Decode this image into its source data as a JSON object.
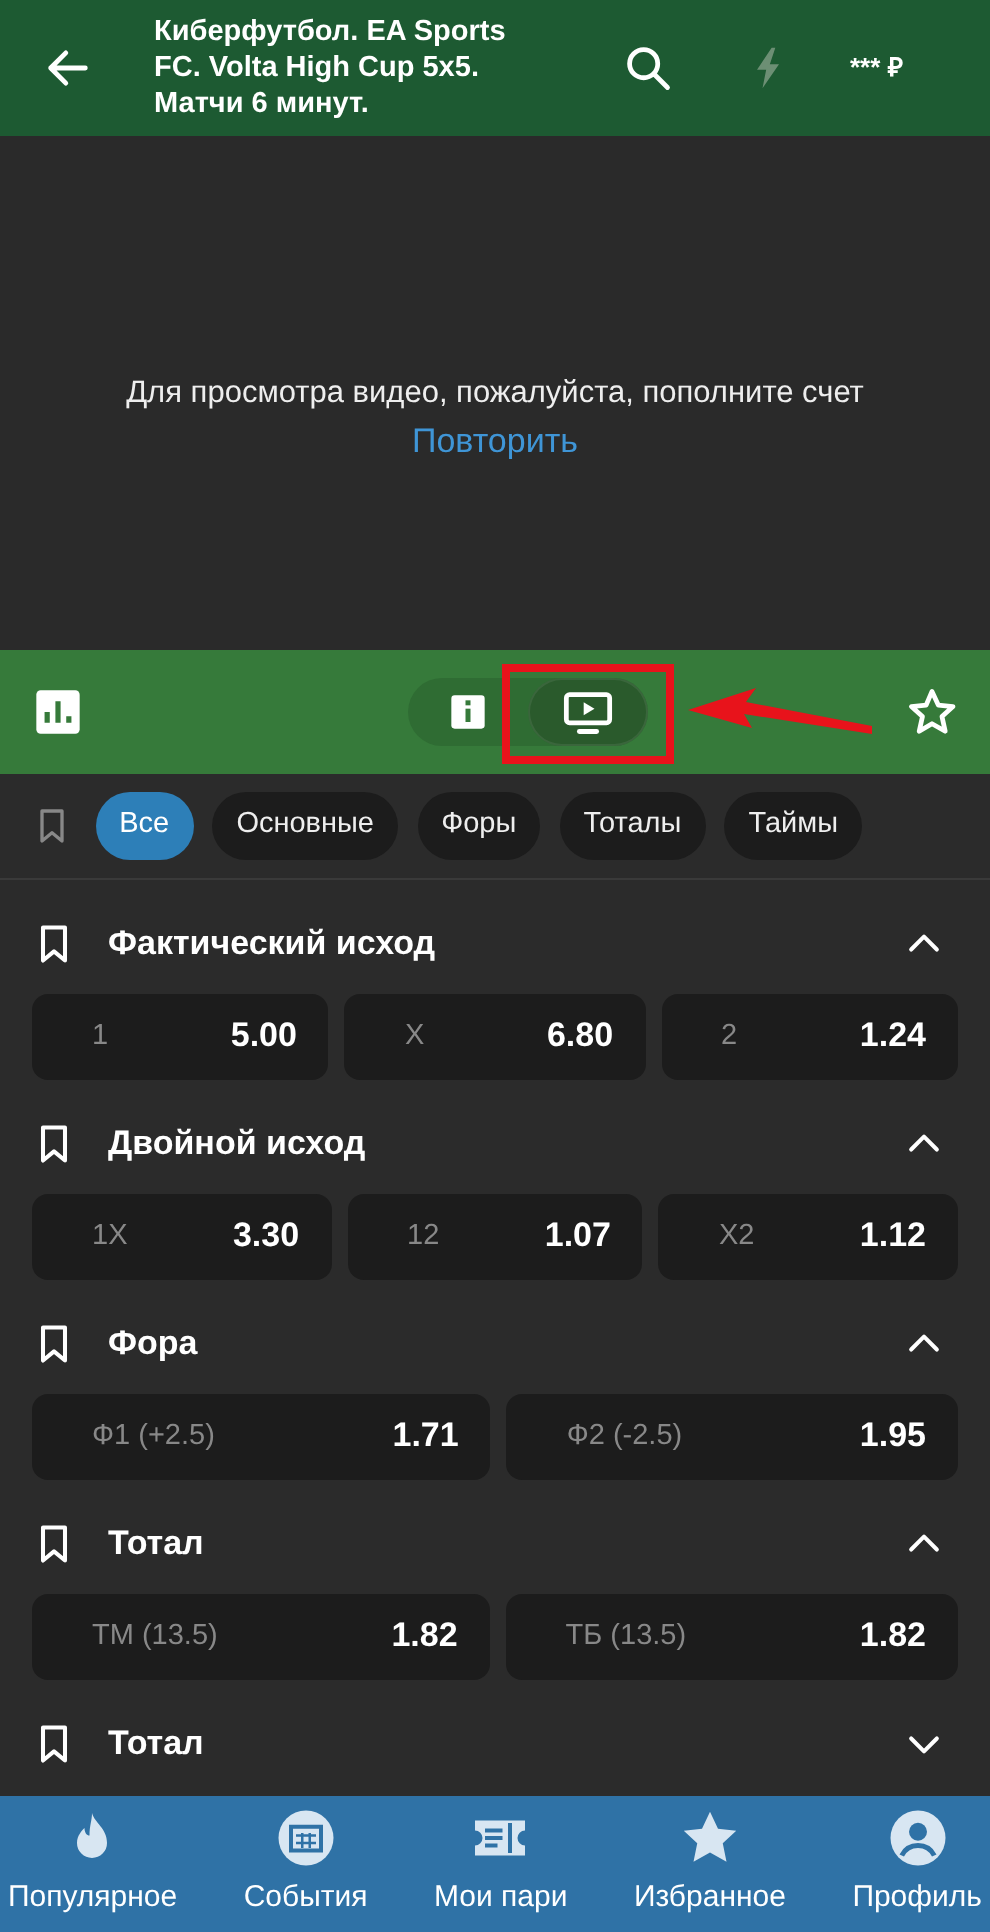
{
  "header": {
    "title": "Киберфутбол. EA Sports FC. Volta High Cup 5x5. Матчи 6 минут.",
    "balance": "*** ₽"
  },
  "video": {
    "message": "Для просмотра видео, пожалуйста, пополните счет",
    "retry": "Повторить"
  },
  "toolbar": {
    "modes": [
      {
        "kind": "info",
        "selected": false,
        "highlighted": false
      },
      {
        "kind": "video",
        "selected": true,
        "highlighted": true
      }
    ]
  },
  "filters": [
    {
      "label": "Все",
      "selected": true
    },
    {
      "label": "Основные",
      "selected": false
    },
    {
      "label": "Форы",
      "selected": false
    },
    {
      "label": "Тоталы",
      "selected": false
    },
    {
      "label": "Таймы",
      "selected": false
    }
  ],
  "markets": [
    {
      "title": "Фактический исход",
      "expanded": true,
      "outcomes": [
        {
          "label": "1",
          "odd": "5.00"
        },
        {
          "label": "X",
          "odd": "6.80"
        },
        {
          "label": "2",
          "odd": "1.24"
        }
      ]
    },
    {
      "title": "Двойной исход",
      "expanded": true,
      "outcomes": [
        {
          "label": "1X",
          "odd": "3.30"
        },
        {
          "label": "12",
          "odd": "1.07"
        },
        {
          "label": "X2",
          "odd": "1.12"
        }
      ]
    },
    {
      "title": "Фора",
      "expanded": true,
      "outcomes": [
        {
          "label": "Ф1 (+2.5)",
          "odd": "1.71"
        },
        {
          "label": "Ф2 (-2.5)",
          "odd": "1.95"
        }
      ]
    },
    {
      "title": "Тотал",
      "expanded": true,
      "outcomes": [
        {
          "label": "ТМ (13.5)",
          "odd": "1.82"
        },
        {
          "label": "ТБ (13.5)",
          "odd": "1.82"
        }
      ]
    },
    {
      "title": "Тотал",
      "expanded": false
    }
  ],
  "nav": [
    {
      "kind": "popular",
      "label": "Популярное"
    },
    {
      "kind": "events",
      "label": "События"
    },
    {
      "kind": "bets",
      "label": "Мои пари"
    },
    {
      "kind": "favorites",
      "label": "Избранное"
    },
    {
      "kind": "profile",
      "label": "Профиль"
    }
  ]
}
